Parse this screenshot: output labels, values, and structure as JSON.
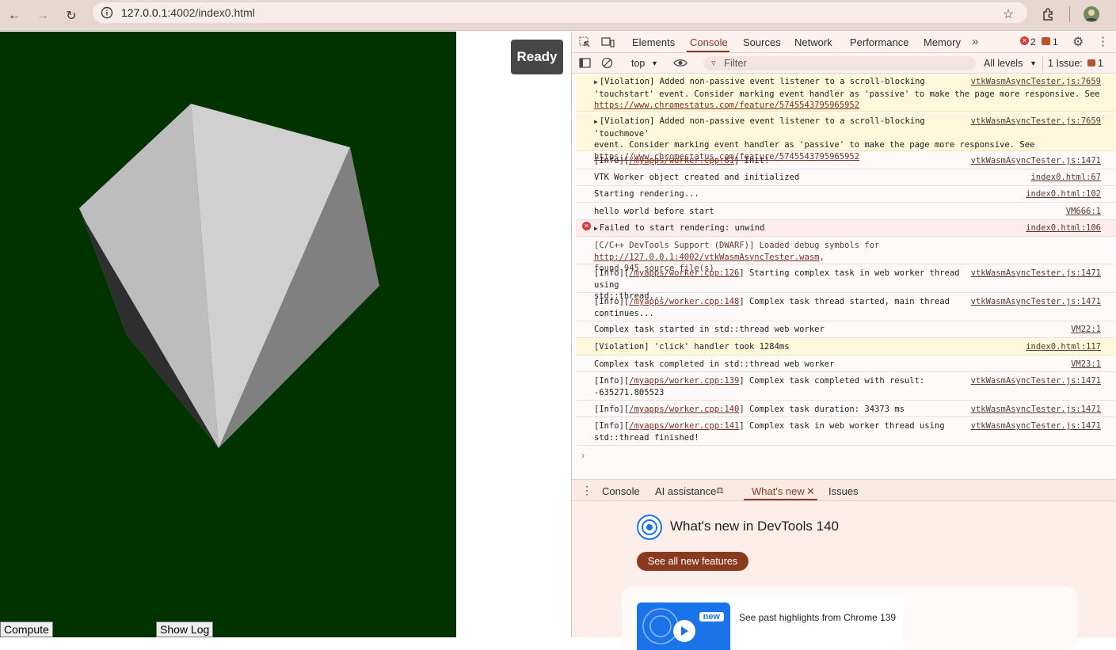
{
  "browser": {
    "url_host": "127.0.0.1",
    "url_rest": ":4002/index0.html"
  },
  "page": {
    "ready_label": "Ready",
    "compute_label": "Compute",
    "show_log_label": "Show Log",
    "canvas_color": "#013300"
  },
  "devtools": {
    "tabs": [
      "Elements",
      "Console",
      "Sources",
      "Network",
      "Performance",
      "Memory"
    ],
    "error_count": "2",
    "warning_count": "1",
    "context": "top",
    "filter_placeholder": "Filter",
    "levels": "All levels",
    "issues_label": "1 Issue:",
    "issues_count": "1"
  },
  "console": {
    "messages": [
      {
        "line1": "[Violation] Added non-passive event listener to a scroll-blocking",
        "line2": "'touchstart' event. Consider marking event handler as 'passive' to make the page more responsive. See",
        "link": "https://www.chromestatus.com/feature/5745543795965952",
        "src": "vtkWasmAsyncTester.js:7659"
      },
      {
        "line1": "[Violation] Added non-passive event listener to a scroll-blocking 'touchmove'",
        "line2": "event. Consider marking event handler as 'passive' to make the page more responsive. See",
        "link": "https://www.chromestatus.com/feature/5745543795965952",
        "src": "vtkWasmAsyncTester.js:7659"
      },
      {
        "pre": "[Info][",
        "file": "/myapps/worker.cpp:81",
        "post": "] Init!",
        "src": "vtkWasmAsyncTester.js:1471"
      },
      {
        "text": "VTK Worker object created and initialized",
        "src": "index0.html:67"
      },
      {
        "text": "Starting rendering...",
        "src": "index0.html:102"
      },
      {
        "text": "hello world before start",
        "src": "VM666:1"
      },
      {
        "text": "Failed to start rendering: unwind",
        "src": "index0.html:106"
      },
      {
        "line1_pre": "[C/C++ DevTools Support (DWARF)] Loaded debug symbols for ",
        "line1_link": "http://127.0.0.1:4002/vtkWasmAsyncTester.wasm",
        "line1_post": ",",
        "line2": "found 945 source file(s)"
      },
      {
        "pre": "[Info][",
        "file": "/myapps/worker.cpp:126",
        "post": "] Starting complex task in web worker thread using",
        "line2": "std::thread...",
        "src": "vtkWasmAsyncTester.js:1471"
      },
      {
        "pre": "[Info][",
        "file": "/myapps/worker.cpp:148",
        "post": "] Complex task thread started, main thread",
        "line2": "continues...",
        "src": "vtkWasmAsyncTester.js:1471"
      },
      {
        "text": "Complex task started in std::thread web worker",
        "src": "VM22:1"
      },
      {
        "text": "[Violation] 'click' handler took 1284ms",
        "src": "index0.html:117"
      },
      {
        "text": "Complex task completed in std::thread web worker",
        "src": "VM23:1"
      },
      {
        "pre": "[Info][",
        "file": "/myapps/worker.cpp:139",
        "post": "] Complex task completed with result:",
        "line2": "-635271.805523",
        "src": "vtkWasmAsyncTester.js:1471"
      },
      {
        "pre": "[Info][",
        "file": "/myapps/worker.cpp:140",
        "post": "] Complex task duration: 34373 ms",
        "src": "vtkWasmAsyncTester.js:1471"
      },
      {
        "pre": "[Info][",
        "file": "/myapps/worker.cpp:141",
        "post": "] Complex task in web worker thread using",
        "line2": "std::thread finished!",
        "src": "vtkWasmAsyncTester.js:1471"
      }
    ]
  },
  "drawer": {
    "tabs": [
      "Console",
      "AI assistance",
      "What's new",
      "Issues"
    ],
    "whats_new_title": "What's new in DevTools 140",
    "see_all_label": "See all new features",
    "new_badge": "new",
    "card_text": "See past highlights from Chrome 139"
  }
}
